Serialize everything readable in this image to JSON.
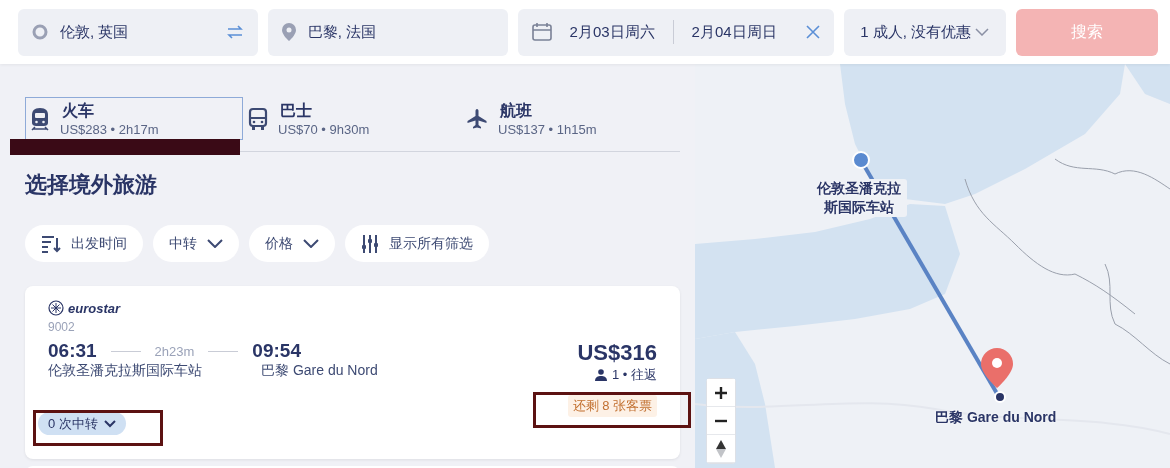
{
  "search_bar": {
    "origin": "伦敦, 英国",
    "destination": "巴黎, 法国",
    "depart_date": "2月03日周六",
    "return_date": "2月04日周日",
    "passengers": "1 成人, 没有优惠",
    "search_button": "搜索"
  },
  "tabs": [
    {
      "kind": "train",
      "label": "火车",
      "summary": "US$283 • 2h17m",
      "selected": true
    },
    {
      "kind": "bus",
      "label": "巴士",
      "summary": "US$70 • 9h30m",
      "selected": false
    },
    {
      "kind": "flight",
      "label": "航班",
      "summary": "US$137 • 1h15m",
      "selected": false
    }
  ],
  "heading": "选择境外旅游",
  "filters": [
    {
      "kind": "sort",
      "label": "出发时间"
    },
    {
      "kind": "dropdown",
      "label": "中转"
    },
    {
      "kind": "dropdown",
      "label": "价格"
    },
    {
      "kind": "all",
      "label": "显示所有筛选"
    }
  ],
  "results": [
    {
      "operator": "eurostar",
      "train_number": "9002",
      "depart_time": "06:31",
      "duration": "2h23m",
      "arrive_time": "09:54",
      "depart_station": "伦敦圣潘克拉斯国际车站",
      "arrive_station": "巴黎 Gare du Nord",
      "price": "US$316",
      "travellers": "1 • 往返",
      "seats_left": "还剩 8 张客票",
      "transfers": "0 次中转"
    }
  ],
  "map": {
    "origin_label": "伦敦圣潘克拉斯国际车站",
    "destination_label": "巴黎 Gare du Nord"
  }
}
